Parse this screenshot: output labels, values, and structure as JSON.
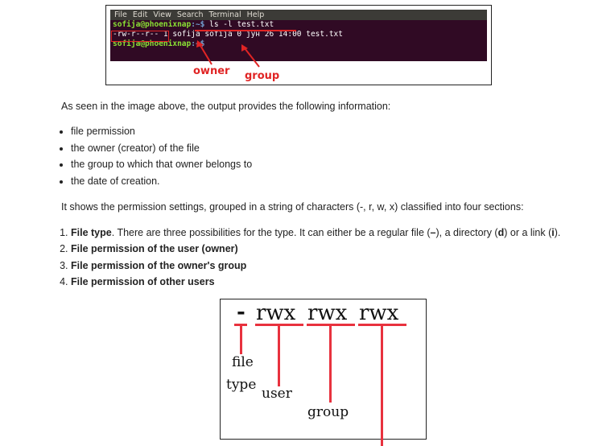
{
  "terminal": {
    "menu": [
      "File",
      "Edit",
      "View",
      "Search",
      "Terminal",
      "Help"
    ],
    "line1": {
      "user_host": "sofija@phoenixnap",
      "path": ":~$",
      "command": " ls -l test.txt"
    },
    "line2": {
      "perms": "-rw-r--r--",
      "rest": " 1 sofija sofija 0 јун 26 14:00 test.txt"
    },
    "line3": {
      "user_host": "sofija@phoenixnap",
      "path": ":~$"
    },
    "annotations": {
      "owner": "owner",
      "group": "group"
    },
    "accent_color": "#e02424"
  },
  "intro": "As seen in the image above, the output provides the following information:",
  "bullets": [
    "file permission",
    "the owner (creator) of the file",
    "the group to which that owner belongs to",
    "the date of creation."
  ],
  "summary": "It shows the permission settings, grouped in a string of characters (-, r, w, x) classified into four sections:",
  "sections": {
    "item1": {
      "bold": "File type",
      "t1": ". There are three possibilities for the type. It can either be a regular file (",
      "b1": "–",
      "t2": "), a directory (",
      "b2": "d",
      "t3": ") or a link (",
      "b3": "i",
      "t4": ")."
    },
    "item2": "File permission of the user (owner)",
    "item3": "File permission of the owner's group",
    "item4": "File permission of other users"
  },
  "diagram": {
    "dash": "-",
    "groups": [
      "rwx",
      "rwx",
      "rwx"
    ],
    "labels": {
      "file": "file",
      "type": "type",
      "user": "user",
      "group": "group"
    },
    "line_color": "#e8323e"
  }
}
